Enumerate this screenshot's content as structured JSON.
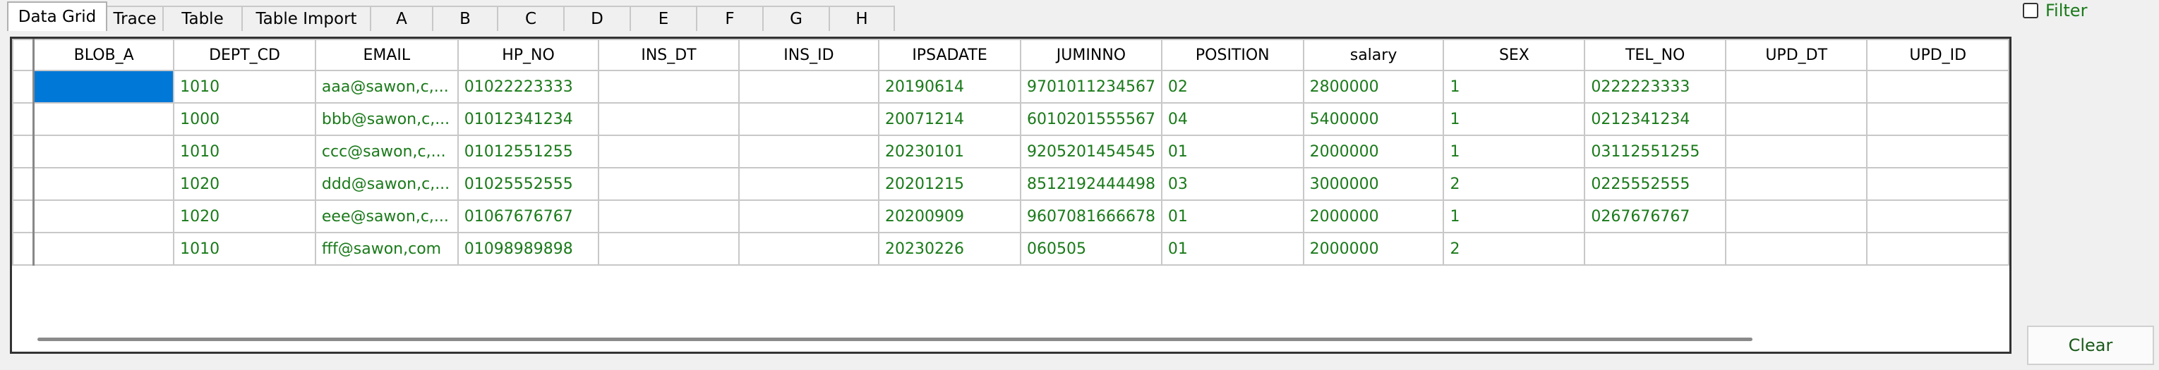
{
  "tabs": [
    {
      "label": "Data Grid",
      "active": true
    },
    {
      "label": "Trace"
    },
    {
      "label": "Table"
    },
    {
      "label": "Table Import"
    },
    {
      "label": "A"
    },
    {
      "label": "B"
    },
    {
      "label": "C"
    },
    {
      "label": "D"
    },
    {
      "label": "E"
    },
    {
      "label": "F"
    },
    {
      "label": "G"
    },
    {
      "label": "H"
    }
  ],
  "grid": {
    "columns": [
      "BLOB_A",
      "DEPT_CD",
      "EMAIL",
      "HP_NO",
      "INS_DT",
      "INS_ID",
      "IPSADATE",
      "JUMINNO",
      "POSITION",
      "salary",
      "SEX",
      "TEL_NO",
      "UPD_DT",
      "UPD_ID"
    ],
    "rows": [
      [
        "",
        "1010",
        "aaa@sawon,c,...",
        "01022223333",
        "",
        "",
        "20190614",
        "9701011234567",
        "02",
        "2800000",
        "1",
        "0222223333",
        "",
        ""
      ],
      [
        "",
        "1000",
        "bbb@sawon,c,...",
        "01012341234",
        "",
        "",
        "20071214",
        "6010201555567",
        "04",
        "5400000",
        "1",
        "0212341234",
        "",
        ""
      ],
      [
        "",
        "1010",
        "ccc@sawon,c,...",
        "01012551255",
        "",
        "",
        "20230101",
        "9205201454545",
        "01",
        "2000000",
        "1",
        "03112551255",
        "",
        ""
      ],
      [
        "",
        "1020",
        "ddd@sawon,c,...",
        "01025552555",
        "",
        "",
        "20201215",
        "8512192444498",
        "03",
        "3000000",
        "2",
        "0225552555",
        "",
        ""
      ],
      [
        "",
        "1020",
        "eee@sawon,c,...",
        "01067676767",
        "",
        "",
        "20200909",
        "9607081666678",
        "01",
        "2000000",
        "1",
        "0267676767",
        "",
        ""
      ],
      [
        "",
        "1010",
        "fff@sawon,com",
        "01098989898",
        "",
        "",
        "20230226",
        "060505",
        "01",
        "2000000",
        "2",
        "",
        "",
        ""
      ]
    ],
    "selected_cell": {
      "row": 0,
      "col": 0
    }
  },
  "filter": {
    "label": "Filter",
    "checked": false
  },
  "clear_button": {
    "label": "Clear"
  },
  "colors": {
    "accent": "#0078d7",
    "cell_text": "#1a7a1a"
  }
}
